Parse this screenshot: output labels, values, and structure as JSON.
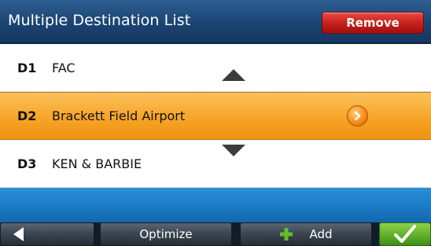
{
  "header": {
    "title": "Multiple Destination List",
    "remove_label": "Remove"
  },
  "destinations": [
    {
      "code": "D1",
      "name": "FAC",
      "selected": false
    },
    {
      "code": "D2",
      "name": "Brackett Field Airport",
      "selected": true
    },
    {
      "code": "D3",
      "name": "KEN & BARBIE",
      "selected": false
    }
  ],
  "toolbar": {
    "optimize_label": "Optimize",
    "add_label": "Add"
  },
  "icons": {
    "back": "back-arrow-icon",
    "scroll_up": "chevron-up-icon",
    "scroll_down": "chevron-down-icon",
    "go": "arrow-right-circle-icon",
    "add": "plus-icon",
    "confirm": "checkmark-icon"
  },
  "colors": {
    "header": "#1b4472",
    "selected_row": "#f7a427",
    "remove_button": "#c8211c",
    "blue_area": "#1d7dc7",
    "confirm_button": "#5fb02a",
    "plus": "#5fbf2a"
  }
}
